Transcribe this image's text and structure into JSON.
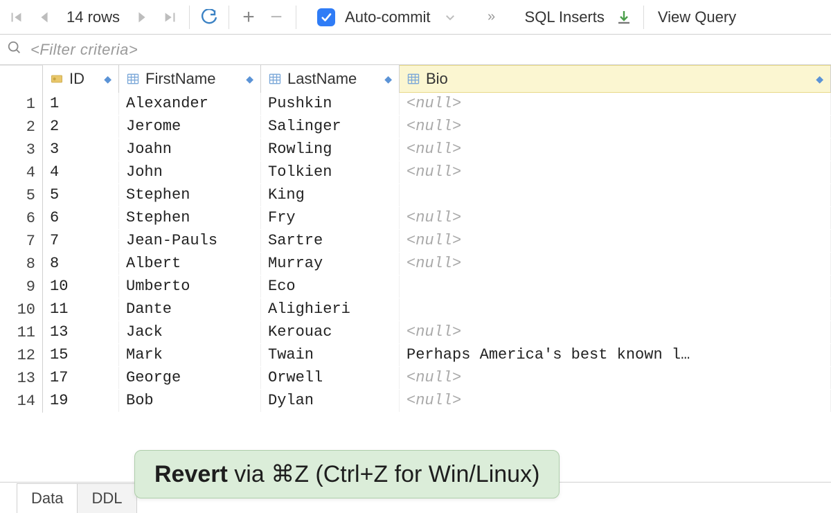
{
  "toolbar": {
    "row_count": "14 rows",
    "auto_commit": "Auto-commit",
    "sql_mode": "SQL Inserts",
    "view_query": "View Query"
  },
  "filter": {
    "placeholder": "<Filter criteria>"
  },
  "columns": {
    "c0": "ID",
    "c1": "FirstName",
    "c2": "LastName",
    "c3": "Bio"
  },
  "rows": [
    {
      "n": "1",
      "id": "1",
      "first": "Alexander",
      "last": "Pushkin",
      "bio": "<null>",
      "bio_null": true
    },
    {
      "n": "2",
      "id": "2",
      "first": "Jerome",
      "last": "Salinger",
      "bio": "<null>",
      "bio_null": true
    },
    {
      "n": "3",
      "id": "3",
      "first": "Joahn",
      "last": "Rowling",
      "bio": "<null>",
      "bio_null": true
    },
    {
      "n": "4",
      "id": "4",
      "first": "John",
      "last": "Tolkien",
      "bio": "<null>",
      "bio_null": true
    },
    {
      "n": "5",
      "id": "5",
      "first": "Stephen",
      "last": "King",
      "bio": "",
      "bio_null": false
    },
    {
      "n": "6",
      "id": "6",
      "first": "Stephen",
      "last": "Fry",
      "bio": "<null>",
      "bio_null": true
    },
    {
      "n": "7",
      "id": "7",
      "first": "Jean-Pauls",
      "last": "Sartre",
      "bio": "<null>",
      "bio_null": true
    },
    {
      "n": "8",
      "id": "8",
      "first": "Albert",
      "last": "Murray",
      "bio": "<null>",
      "bio_null": true
    },
    {
      "n": "9",
      "id": "10",
      "first": "Umberto",
      "last": "Eco",
      "bio": "",
      "bio_null": false
    },
    {
      "n": "10",
      "id": "11",
      "first": "Dante",
      "last": "Alighieri",
      "bio": "",
      "bio_null": false
    },
    {
      "n": "11",
      "id": "13",
      "first": "Jack",
      "last": "Kerouac",
      "bio": "<null>",
      "bio_null": true
    },
    {
      "n": "12",
      "id": "15",
      "first": "Mark",
      "last": "Twain",
      "bio": "Perhaps America's best known l…",
      "bio_null": false
    },
    {
      "n": "13",
      "id": "17",
      "first": "George",
      "last": "Orwell",
      "bio": "<null>",
      "bio_null": true
    },
    {
      "n": "14",
      "id": "19",
      "first": "Bob",
      "last": "Dylan",
      "bio": "<null>",
      "bio_null": true
    }
  ],
  "tabs": {
    "data": "Data",
    "ddl": "DDL"
  },
  "hint": {
    "strong": "Revert",
    "rest": " via ⌘Z (Ctrl+Z for Win/Linux)"
  }
}
